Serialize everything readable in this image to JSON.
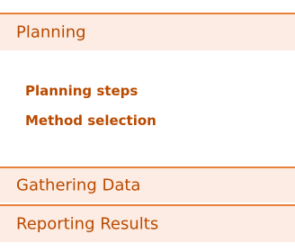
{
  "nav": {
    "sections": [
      {
        "label": "Planning",
        "expanded": true,
        "items": [
          {
            "label": "Planning steps"
          },
          {
            "label": "Method selection"
          }
        ]
      },
      {
        "label": "Gathering Data"
      },
      {
        "label": "Reporting Results"
      }
    ]
  },
  "colors": {
    "accent": "#e8803a",
    "text": "#b94a00",
    "header_bg": "#fdece3"
  }
}
